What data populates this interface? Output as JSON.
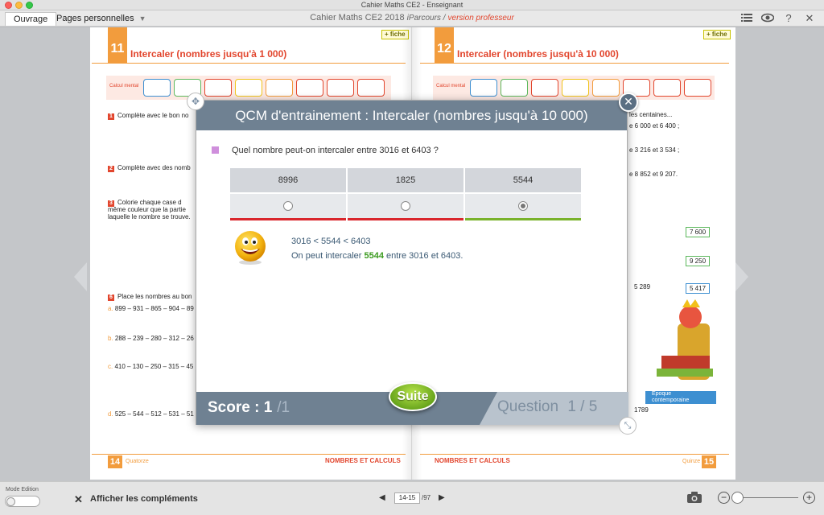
{
  "window": {
    "title": "Cahier Maths CE2 - Enseignant"
  },
  "toolbar": {
    "tab_ouvrage": "Ouvrage",
    "tab_pages": "Pages personnelles",
    "doc_title": "Cahier Maths CE2 2018",
    "doc_sub": "iParcours /",
    "doc_version": "version professeur",
    "icons": [
      "list-icon",
      "eye-icon",
      "help-icon",
      "close-icon"
    ]
  },
  "left_page": {
    "lesson_number": "11",
    "lesson_title": "Intercaler (nombres  jusqu'à 1 000)",
    "fiche": "+ fiche",
    "calc_label": "Calcul mental",
    "ex1": "Complète avec le bon no",
    "ex2": "Complète avec des nomb",
    "ex3_l1": "Colorie chaque case d",
    "ex3_l2": "même couleur que la partie",
    "ex3_l3": "laquelle le nombre se trouve.",
    "ex6": "Place les nombres au bon",
    "a_line": "899 – 931 – 865 – 904 – 89",
    "b_line": "288 – 239 – 280 – 312 – 26",
    "c_line": "410 – 130 – 250 – 315 – 45",
    "d_line": "525 – 544 – 512 – 531 – 51",
    "footer_label": "NOMBRES ET CALCULS",
    "page_number": "14",
    "page_name": "Quatorze"
  },
  "right_page": {
    "lesson_number": "12",
    "lesson_title": "Intercaler (nombres  jusqu'à 10 000)",
    "fiche": "+ fiche",
    "calc_label": "Calcul mental",
    "line1": "les centaines...",
    "line2": "e 6 000 et 6 400 ;",
    "line3": "e 3 216 et 3 534 ;",
    "line4": "e 8 852 et 9 207.",
    "val1": "7 600",
    "val2": "9 250",
    "val3": "5 289",
    "val4": "5 417",
    "epoque": "Époque contemporaine",
    "year": "1789",
    "footer_label": "NOMBRES ET CALCULS",
    "page_number": "15",
    "page_name": "Quinze"
  },
  "modal": {
    "title": "QCM d'entrainement : Intercaler (nombres jusqu'à 10 000)",
    "question": "Quel nombre peut-on intercaler entre 3016 et 6403 ?",
    "choices": [
      {
        "value": "8996",
        "selected": false,
        "bar_color": "#d9262c"
      },
      {
        "value": "1825",
        "selected": false,
        "bar_color": "#d9262c"
      },
      {
        "value": "5544",
        "selected": true,
        "bar_color": "#79b22b"
      }
    ],
    "feedback_line1": "3016 < 5544 < 6403",
    "feedback_pre": "On peut intercaler ",
    "feedback_answer": "5544",
    "feedback_post": " entre 3016 et 6403.",
    "score_label": "Score : 1",
    "score_total": "/1",
    "suite": "Suite",
    "question_label": "Question",
    "question_current": "1 / 5"
  },
  "bottombar": {
    "mode_label": "Mode Edition",
    "complements_label": "Afficher les compléments",
    "page_value": "14-15",
    "page_total": "/97"
  }
}
